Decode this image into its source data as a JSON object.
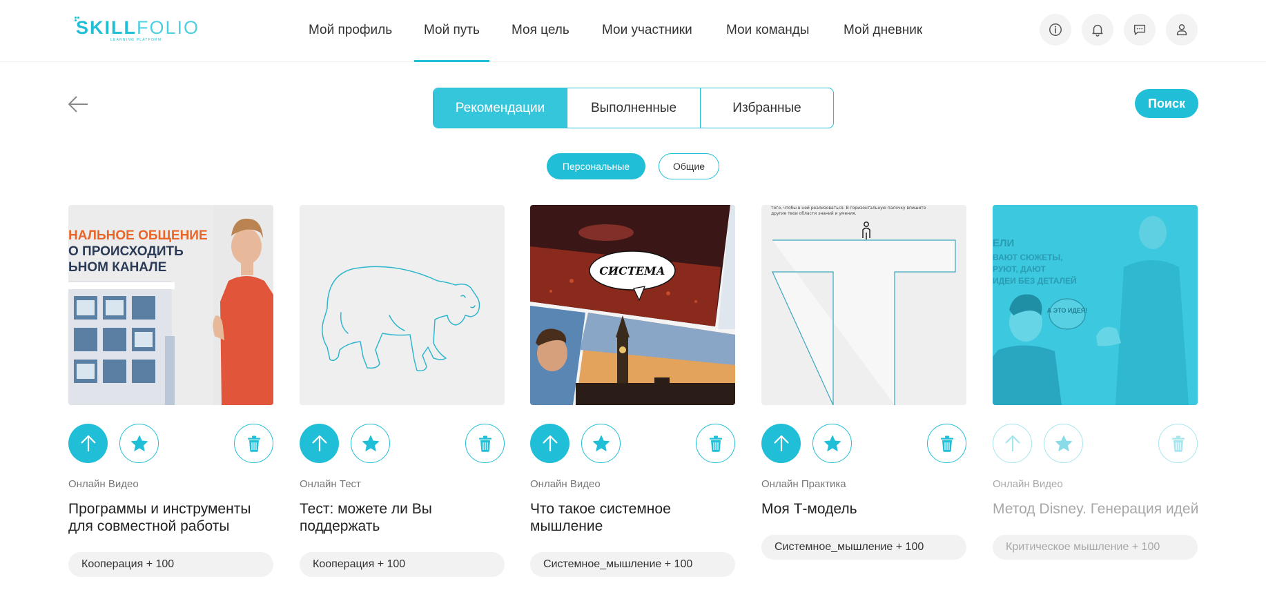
{
  "brand": {
    "name_part1": "SKILL",
    "name_part2": "FOLIO",
    "tagline": "LEARNING PLATFORM",
    "accent": "#21bfd7"
  },
  "nav": {
    "items": [
      {
        "label": "Мой профиль"
      },
      {
        "label": "Мой путь",
        "active": true
      },
      {
        "label": "Моя цель"
      },
      {
        "label": "Мои участники"
      },
      {
        "label": "Мои команды"
      },
      {
        "label": "Мой дневник"
      }
    ],
    "icons": [
      "info-icon",
      "bell-icon",
      "chat-icon",
      "user-icon"
    ]
  },
  "tabs": [
    {
      "label": "Рекомендации",
      "active": true
    },
    {
      "label": "Выполненные"
    },
    {
      "label": "Избранные"
    }
  ],
  "search": {
    "label": "Поиск"
  },
  "filters": [
    {
      "label": "Персональные",
      "active": true
    },
    {
      "label": "Общие"
    }
  ],
  "cards": [
    {
      "type": "Онлайн Видео",
      "title": "Программы и инструменты для совместной работы",
      "tag": "Кооперация + 100",
      "image": {
        "lines": [
          "НАЛЬНОЕ ОБЩЕНИЕ",
          "О ПРОИСХОДИТЬ",
          "ЬНОМ КАНАЛЕ"
        ]
      }
    },
    {
      "type": "Онлайн Тест",
      "title": "Тест: можете ли Вы поддержать",
      "tag": "Кооперация + 100",
      "image": {}
    },
    {
      "type": "Онлайн Видео",
      "title": "Что такое системное мышление",
      "tag": "Системное_мышление + 100",
      "image": {
        "bubble": "СИСТЕМА"
      }
    },
    {
      "type": "Онлайн Практика",
      "title": "Моя Т-модель",
      "tag": "Системное_мышление + 100",
      "image": {
        "caption_line1": "того, чтобы в ней реализоваться. В горизонтальную палочку впишите",
        "caption_line2": "другие твои области знаний и умения."
      }
    },
    {
      "type": "Онлайн Видео",
      "title": "Метод Disney. Генерация идей",
      "tag": "Критическое мышление + 100",
      "faded": true,
      "image": {
        "lines": [
          "ЕЛИ",
          "ВАЮТ СЮЖЕТЫ,",
          "РУЮТ, ДАЮТ",
          "ИДЕИ БЕЗ ДЕТАЛЕЙ"
        ],
        "bubble": "А ЭТО ИДЕЯ!"
      }
    }
  ]
}
